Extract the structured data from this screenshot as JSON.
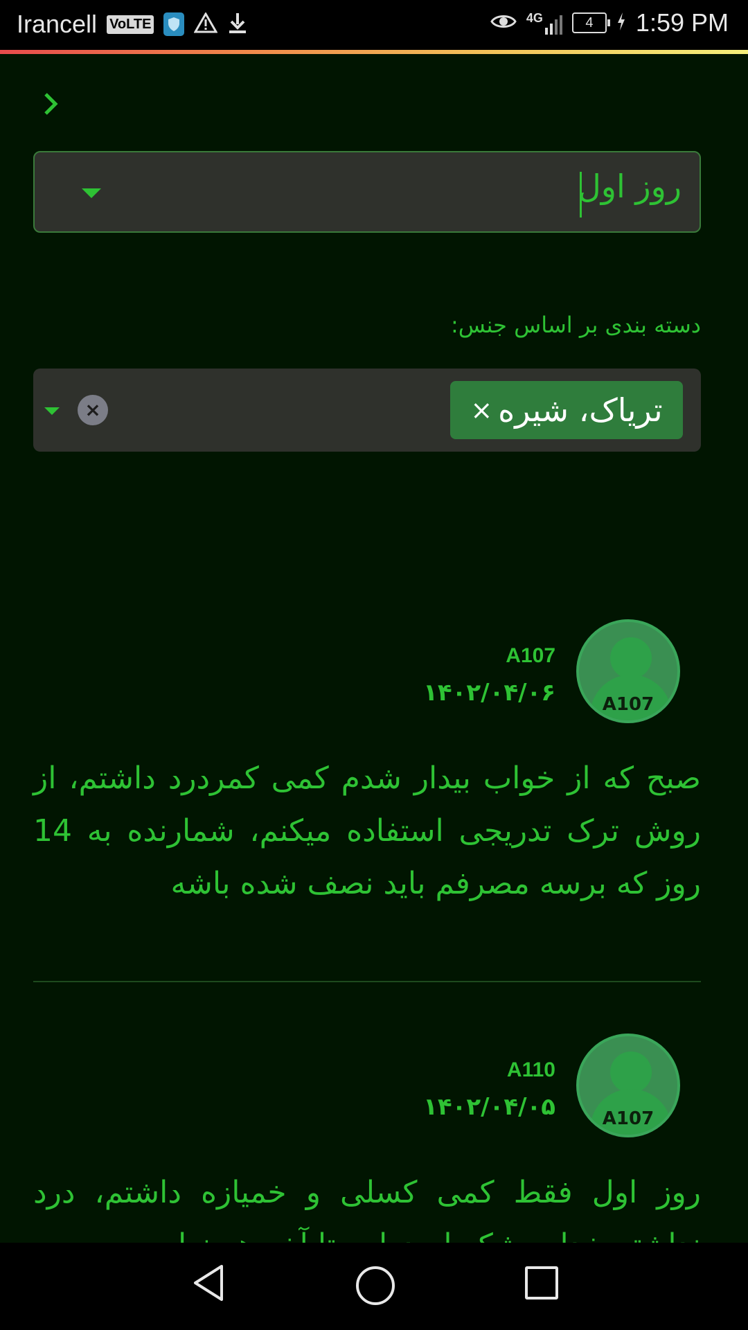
{
  "status_bar": {
    "carrier": "Irancell",
    "volte": "VoLTE",
    "network": "4G",
    "battery": "4",
    "time": "1:59 PM",
    "icons": [
      "shield-icon",
      "warning-icon",
      "download-icon",
      "eye-icon",
      "signal-icon",
      "battery-icon",
      "charging-icon"
    ]
  },
  "accent_color": "#2ec234",
  "background_color": "#011501",
  "filters": {
    "day_select": {
      "value": "روز اول"
    },
    "category_label": "دسته بندی بر اساس جنس:",
    "category_select": {
      "chip_label": "تریاک، شیره",
      "chip_remove": "×",
      "clear": "×"
    }
  },
  "posts": [
    {
      "username": "A107",
      "avatar_text": "A107",
      "date": "۱۴۰۲/۰۴/۰۶",
      "text": "صبح که از خواب بیدار شدم کمی کمردرد داشتم، از روش ترک تدریجی استفاده میکنم، شمارنده به 14 روز که برسه مصرفم باید نصف شده باشه"
    },
    {
      "username": "A110",
      "avatar_text": "A107",
      "date": "۱۴۰۲/۰۴/۰۵",
      "text": "روز اول فقط کمی کسلی و خمیازه داشتم، درد نداشتم خدارو شکر امیدوارم تا آخر همینطور"
    }
  ]
}
